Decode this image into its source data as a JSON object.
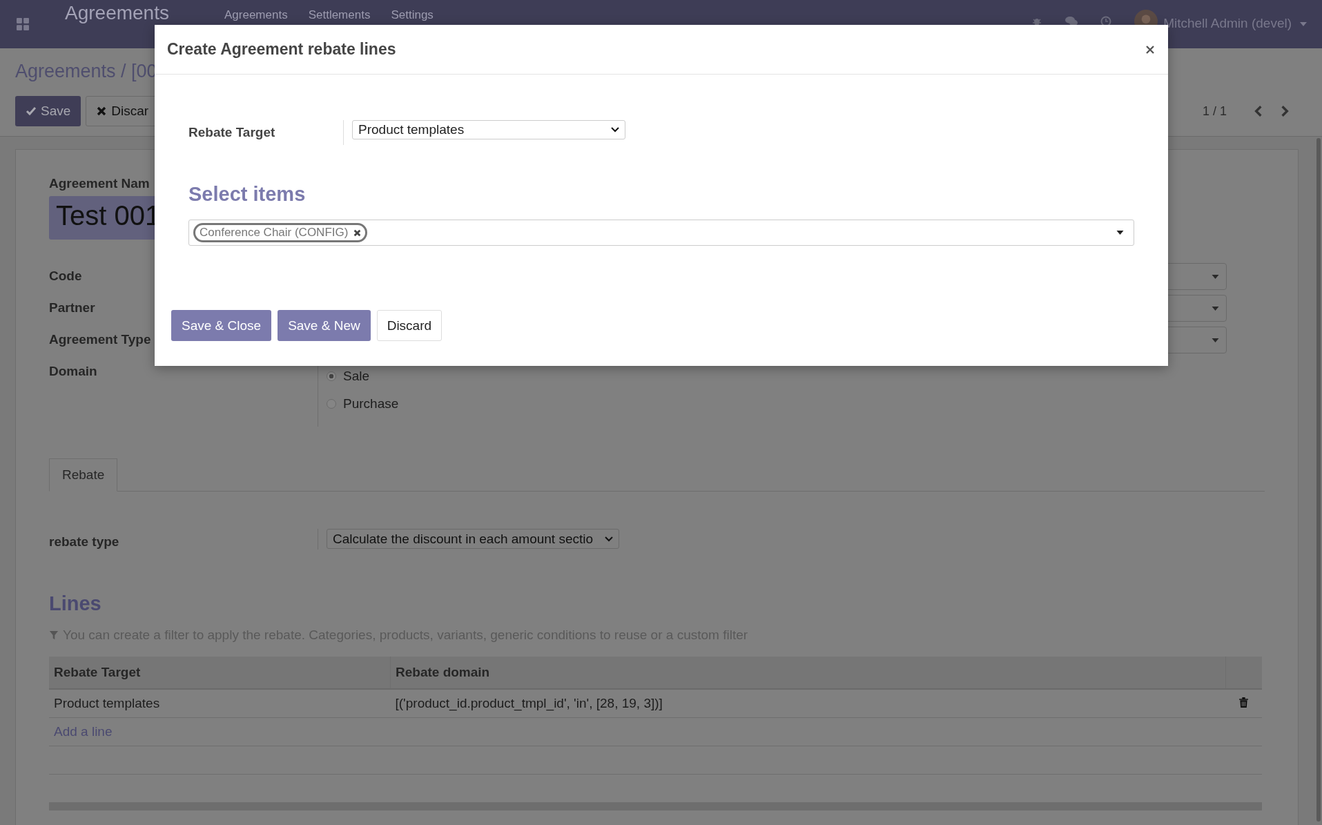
{
  "navbar": {
    "app_title": "Agreements",
    "menu": [
      "Agreements",
      "Settlements",
      "Settings"
    ],
    "user": "Mitchell Admin (devel)"
  },
  "control_panel": {
    "breadcrumb": "Agreements / [00",
    "buttons": [
      {
        "label": "Save",
        "kind": "primary"
      },
      {
        "label": "Discar",
        "kind": "secondary"
      }
    ],
    "pager": "1 / 1"
  },
  "form": {
    "name_label": "Agreement Nam",
    "name_value": "Test 001",
    "fields": [
      "Code",
      "Partner",
      "Agreement Type"
    ],
    "domain": {
      "label": "Domain",
      "options": [
        {
          "label": "Sale",
          "selected": true
        },
        {
          "label": "Purchase",
          "selected": false
        }
      ]
    },
    "tabs": [
      {
        "label": "Rebate",
        "selected": true
      }
    ],
    "rebate_type": {
      "label": "rebate type",
      "value": "Calculate the discount in each amount sectio"
    },
    "lines": {
      "title": "Lines",
      "hint": "You can create a filter to apply the rebate. Categories, products, variants, generic conditions to reuse or a custom filter",
      "columns": [
        "Rebate Target",
        "Rebate domain"
      ],
      "rows": [
        {
          "target": "Product templates",
          "domain": "[('product_id.product_tmpl_id', 'in', [28, 19, 3])]"
        }
      ],
      "add_line": "Add a line"
    }
  },
  "dialog": {
    "title": "Create Agreement rebate lines",
    "target_label": "Rebate Target",
    "target_value": "Product templates",
    "section_title": "Select items",
    "tags": [
      "Conference Chair (CONFIG)"
    ],
    "buttons": [
      {
        "label": "Save & Close",
        "kind": "primary"
      },
      {
        "label": "Save & New",
        "kind": "primary"
      },
      {
        "label": "Discard",
        "kind": "secondary"
      }
    ]
  }
}
